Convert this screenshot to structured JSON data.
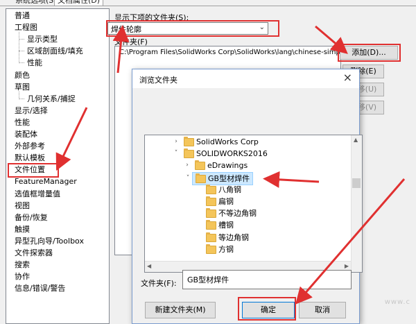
{
  "tabs": [
    {
      "label": "系统选项(S)"
    },
    {
      "label": "文档属性(D)"
    }
  ],
  "left_tree": [
    {
      "label": "普通",
      "indent": 0
    },
    {
      "label": "工程图",
      "indent": 0
    },
    {
      "label": "显示类型",
      "indent": 2
    },
    {
      "label": "区域剖面线/填充",
      "indent": 2
    },
    {
      "label": "性能",
      "indent": 2
    },
    {
      "label": "颜色",
      "indent": 0
    },
    {
      "label": "草图",
      "indent": 0
    },
    {
      "label": "几何关系/捕捉",
      "indent": 2
    },
    {
      "label": "显示/选择",
      "indent": 0
    },
    {
      "label": "性能",
      "indent": 0
    },
    {
      "label": "装配体",
      "indent": 0
    },
    {
      "label": "外部参考",
      "indent": 0
    },
    {
      "label": "默认模板",
      "indent": 0
    },
    {
      "label": "文件位置",
      "indent": 0
    },
    {
      "label": "FeatureManager",
      "indent": 0
    },
    {
      "label": "选值框增量值",
      "indent": 0
    },
    {
      "label": "视图",
      "indent": 0
    },
    {
      "label": "备份/恢复",
      "indent": 0
    },
    {
      "label": "触摸",
      "indent": 0
    },
    {
      "label": "异型孔向导/Toolbox",
      "indent": 0
    },
    {
      "label": "文件探索器",
      "indent": 0
    },
    {
      "label": "搜索",
      "indent": 0
    },
    {
      "label": "协作",
      "indent": 0
    },
    {
      "label": "信息/错误/警告",
      "indent": 0
    }
  ],
  "right": {
    "show_folders_label": "显示下项的文件夹(S):",
    "combo_value": "焊件轮廓",
    "folders_label": "文件夹(F)",
    "path_value": "C:\\Program Files\\SolidWorks Corp\\SolidWorks\\lang\\chinese-simplified\\w",
    "add_button": "添加(D)...",
    "delete_button": "删除(E)",
    "move_up_button": "上移(U)",
    "move_down_button": "下移(V)"
  },
  "dialog": {
    "title": "浏览文件夹",
    "close_glyph": "×",
    "folders": [
      {
        "label": "SolidWorks Corp",
        "level": 0,
        "expander": "›",
        "selected": false
      },
      {
        "label": "SOLIDWORKS2016",
        "level": 0,
        "expander": "˅",
        "selected": false
      },
      {
        "label": "eDrawings",
        "level": 1,
        "expander": "›",
        "selected": false
      },
      {
        "label": "GB型材焊件",
        "level": 1,
        "expander": "˅",
        "selected": true
      },
      {
        "label": "八角钢",
        "level": 2,
        "expander": "",
        "selected": false
      },
      {
        "label": "扁钢",
        "level": 2,
        "expander": "",
        "selected": false
      },
      {
        "label": "不等边角钢",
        "level": 2,
        "expander": "",
        "selected": false
      },
      {
        "label": "槽钢",
        "level": 2,
        "expander": "",
        "selected": false
      },
      {
        "label": "等边角钢",
        "level": 2,
        "expander": "",
        "selected": false
      },
      {
        "label": "方钢",
        "level": 2,
        "expander": "",
        "selected": false
      }
    ],
    "folder_field_label": "文件夹(F):",
    "folder_field_value": "GB型材焊件",
    "new_folder_button": "新建文件夹(M)",
    "ok_button": "确定",
    "cancel_button": "取消"
  },
  "watermark": "www.c",
  "colors": {
    "annotation_red": "#e03030",
    "selection": "#cce8ff",
    "folder": "#f4c55a"
  }
}
